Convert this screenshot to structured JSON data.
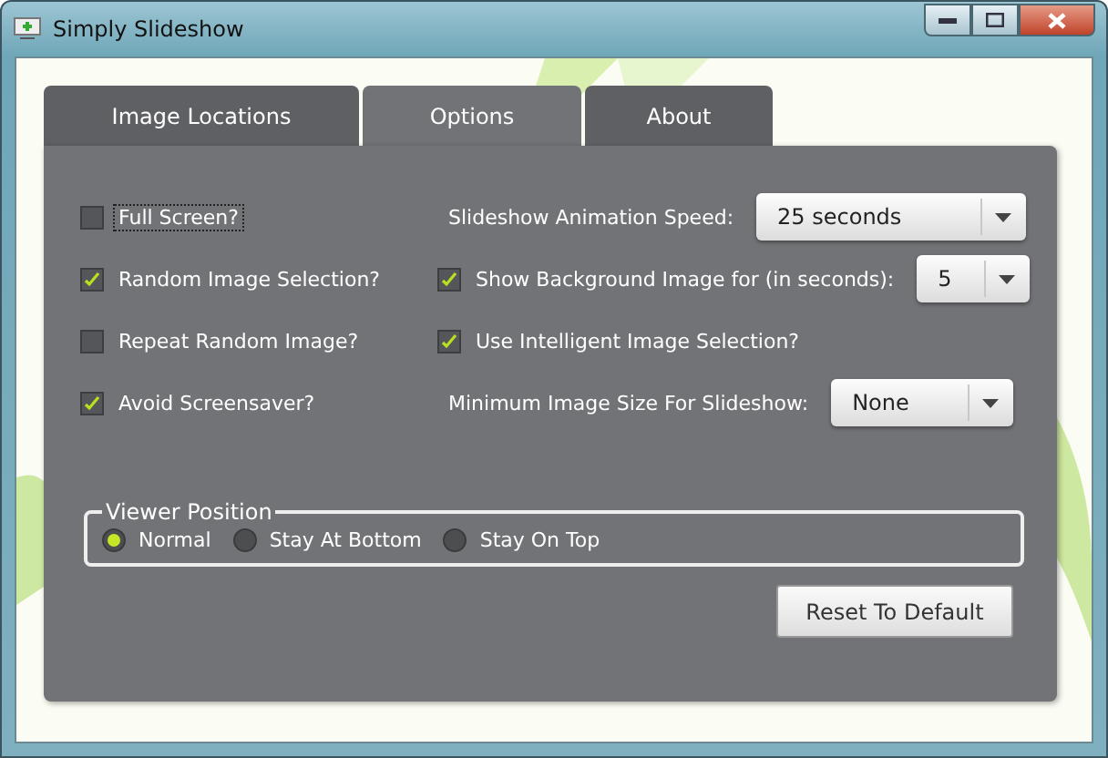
{
  "window": {
    "title": "Simply Slideshow"
  },
  "tabs": [
    {
      "label": "Image Locations",
      "selected": false
    },
    {
      "label": "Options",
      "selected": true
    },
    {
      "label": "About",
      "selected": false
    }
  ],
  "left_options": [
    {
      "label": "Full Screen?",
      "checked": false,
      "focused": true
    },
    {
      "label": "Random Image Selection?",
      "checked": true,
      "focused": false
    },
    {
      "label": "Repeat Random Image?",
      "checked": false,
      "focused": false
    },
    {
      "label": "Avoid Screensaver?",
      "checked": true,
      "focused": false
    }
  ],
  "right_options": [
    {
      "kind": "dropdown",
      "label": "Slideshow Animation Speed:",
      "value": "25 seconds"
    },
    {
      "kind": "checkdropdown",
      "label": "Show Background Image for (in seconds):",
      "checked": true,
      "value": "5"
    },
    {
      "kind": "checkbox",
      "label": "Use Intelligent Image Selection?",
      "checked": true
    },
    {
      "kind": "dropdown",
      "label": "Minimum Image Size For Slideshow:",
      "value": "None"
    }
  ],
  "viewer_position": {
    "title": "Viewer Position",
    "options": [
      {
        "label": "Normal",
        "selected": true
      },
      {
        "label": "Stay At Bottom",
        "selected": false
      },
      {
        "label": "Stay On Top",
        "selected": false
      }
    ]
  },
  "reset_button": "Reset To Default"
}
